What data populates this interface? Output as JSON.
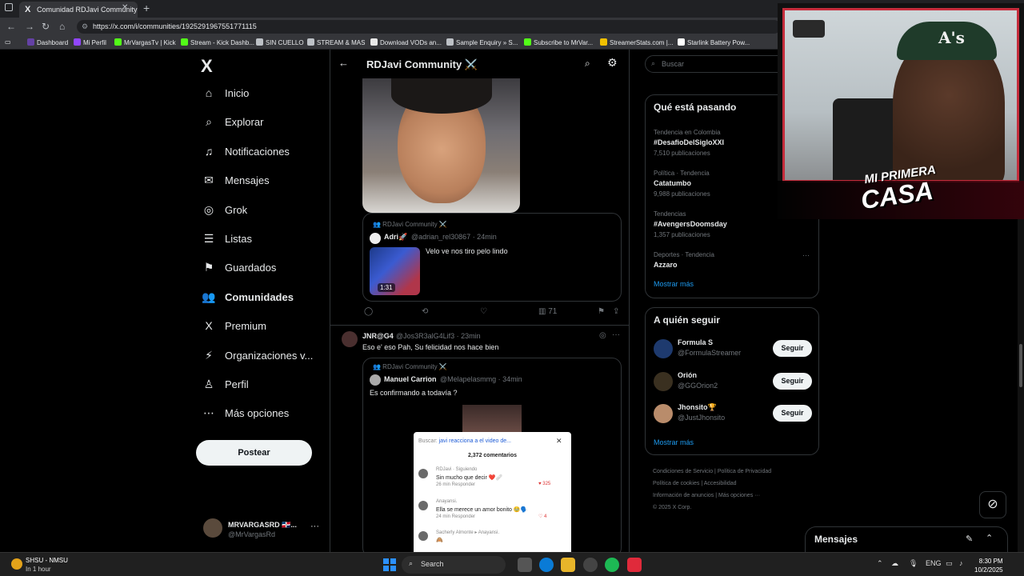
{
  "browser": {
    "tab_title": "Comunidad RDJavi Community",
    "tab_close": "✕",
    "new_tab": "+",
    "url": "https://x.com/i/communities/1925291967551771115",
    "bookmarks": [
      {
        "label": "Dashboard",
        "color": "#6441a5"
      },
      {
        "label": "Mi Perfil",
        "color": "#9146ff"
      },
      {
        "label": "MrVargasTv | Kick",
        "color": "#53fc18"
      },
      {
        "label": "Stream - Kick Dashb...",
        "color": "#53fc18"
      },
      {
        "label": "SIN CUELLO",
        "color": "#bdc1c6"
      },
      {
        "label": "STREAM & MAS",
        "color": "#bdc1c6"
      },
      {
        "label": "Download VODs an...",
        "color": "#e8e8e8"
      },
      {
        "label": "Sample Enquiry » S...",
        "color": "#bdc1c6"
      },
      {
        "label": "Subscribe to MrVar...",
        "color": "#53fc18"
      },
      {
        "label": "StreamerStats.com |...",
        "color": "#f0c000"
      },
      {
        "label": "Starlink Battery Pow...",
        "color": "#ffffff"
      }
    ]
  },
  "sidebar": {
    "logo": "X",
    "items": [
      {
        "label": "Inicio",
        "icon": "home-icon",
        "glyph": "⌂"
      },
      {
        "label": "Explorar",
        "icon": "search-icon",
        "glyph": "⌕"
      },
      {
        "label": "Notificaciones",
        "icon": "bell-icon",
        "glyph": "♫"
      },
      {
        "label": "Mensajes",
        "icon": "mail-icon",
        "glyph": "✉"
      },
      {
        "label": "Grok",
        "icon": "grok-icon",
        "glyph": "◎"
      },
      {
        "label": "Listas",
        "icon": "list-icon",
        "glyph": "☰"
      },
      {
        "label": "Guardados",
        "icon": "bookmark-icon",
        "glyph": "⚑"
      },
      {
        "label": "Comunidades",
        "icon": "communities-icon",
        "glyph": "👥"
      },
      {
        "label": "Premium",
        "icon": "x-premium-icon",
        "glyph": "X"
      },
      {
        "label": "Organizaciones v...",
        "icon": "lightning-icon",
        "glyph": "⚡"
      },
      {
        "label": "Perfil",
        "icon": "person-icon",
        "glyph": "♙"
      },
      {
        "label": "Más opciones",
        "icon": "more-circle-icon",
        "glyph": "⋯"
      }
    ],
    "post_button": "Postear",
    "profile_name": "MRVARGASRD 🇩🇴...",
    "profile_handle": "@MrVargasRd",
    "profile_more": "···"
  },
  "feed": {
    "title": "RDJavi Community ⚔️",
    "post1": {
      "quote_community": "👥 RDJavi Community ⚔️",
      "quote_name": "Adri🚀",
      "quote_handle": "@adrian_rel30867 · 24min",
      "quote_text": "Velo ve nos tiro pelo lindo",
      "video_duration": "1:31",
      "views": "71"
    },
    "post2": {
      "name": "JNR@G4",
      "handle": "@Jos3R3alG4Lif3 · 23min",
      "text": "Eso e' eso Pah, Su felicidad nos hace bien",
      "quote_community": "👥 RDJavi Community ⚔️",
      "quote_name": "Manuel Carrion",
      "quote_handle": "@Melapelasmmg · 34min",
      "quote_text": "Es confirmando a todavía ?",
      "modal": {
        "search_label": "Buscar:",
        "search_query": "javi reacciona a el video de...",
        "count": "2,372 comentarios",
        "comments": [
          {
            "user": "RDJavi · Siguiendo",
            "text": "Sin mucho que decir ❤️🩹",
            "meta": "26 min    Responder",
            "likes": "♥ 325"
          },
          {
            "user": "Anayansi.",
            "text": "Ella se merece un amor bonito 🥹🗣️",
            "meta": "24 min    Responder",
            "likes": "♡ 4"
          },
          {
            "user": "Sacherly Almonte ▸ Anayansi.",
            "text": "🙈",
            "meta": "",
            "likes": ""
          }
        ]
      }
    }
  },
  "right": {
    "search_placeholder": "Buscar",
    "trends_title": "Qué está pasando",
    "trends": [
      {
        "context": "Tendencia en Colombia",
        "name": "#DesafioDelSigloXXI",
        "count": "7,510 publicaciones",
        "more": ""
      },
      {
        "context": "Política · Tendencia",
        "name": "Catatumbo",
        "count": "9,988 publicaciones",
        "more": ""
      },
      {
        "context": "Tendencias",
        "name": "#AvengersDoomsday",
        "count": "1,357 publicaciones",
        "more": "···"
      },
      {
        "context": "Deportes · Tendencia",
        "name": "Azzaro",
        "count": "",
        "more": "···"
      }
    ],
    "show_more": "Mostrar más",
    "follow_title": "A quién seguir",
    "follow": [
      {
        "name": "Formula S",
        "handle": "@FormulaStreamer",
        "button": "Seguir",
        "color": "#1e3a6e"
      },
      {
        "name": "Orión",
        "handle": "@GGOrion2",
        "button": "Seguir",
        "color": "#3a3020"
      },
      {
        "name": "Jhonsito🏆",
        "handle": "@JustJhonsito",
        "button": "Seguir",
        "color": "#b98c6b"
      }
    ],
    "footer": [
      "Condiciones de Servicio",
      "Política de Privacidad",
      "Política de cookies",
      "Accesibilidad",
      "Información de anuncios",
      "Más opciones ···",
      "© 2025 X Corp."
    ],
    "messages_title": "Mensajes"
  },
  "webcam": {
    "cap_logo": "A's",
    "title_line1": "MI PRIMERA",
    "title_line2": "CASA"
  },
  "taskbar": {
    "weather_line1": "SHSU - NMSU",
    "weather_line2": "In 1 hour",
    "search_label": "Search",
    "lang": "ENG",
    "time": "8:30 PM",
    "date": "10/2/2025"
  }
}
